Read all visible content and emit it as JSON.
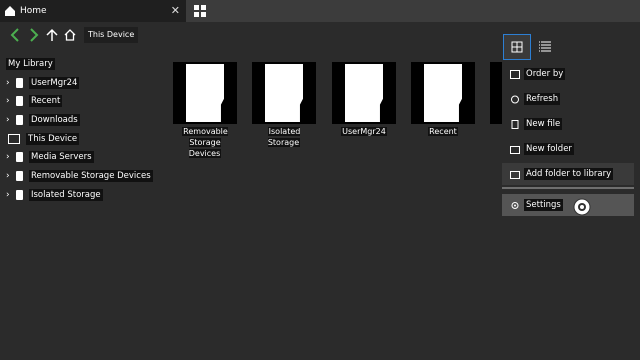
{
  "tab": {
    "title": "Home",
    "close": "✕"
  },
  "breadcrumb": {
    "current": "This Device"
  },
  "tree": {
    "library_header": "My Library",
    "library_items": [
      {
        "label": "UserMgr24"
      },
      {
        "label": "Recent"
      },
      {
        "label": "Downloads"
      }
    ],
    "device_header": "This Device",
    "device_items": [
      {
        "label": "Media Servers"
      },
      {
        "label": "Removable Storage Devices"
      },
      {
        "label": "Isolated Storage"
      }
    ]
  },
  "files": [
    {
      "label": "Removable Storage Devices"
    },
    {
      "label": "Isolated Storage"
    },
    {
      "label": "UserMgr24"
    },
    {
      "label": "Recent"
    }
  ],
  "menu": {
    "items": [
      {
        "label": "Order by",
        "icon": "order-icon"
      },
      {
        "label": "Refresh",
        "icon": "refresh-icon"
      },
      {
        "label": "New file",
        "icon": "file-icon"
      },
      {
        "label": "New folder",
        "icon": "folder-icon"
      },
      {
        "label": "Add folder to library",
        "icon": "library-icon"
      },
      {
        "label": "Settings",
        "icon": "gear-icon"
      }
    ]
  },
  "colors": {
    "accent": "#2d7fd3",
    "nav_arrow": "#4caf50"
  }
}
